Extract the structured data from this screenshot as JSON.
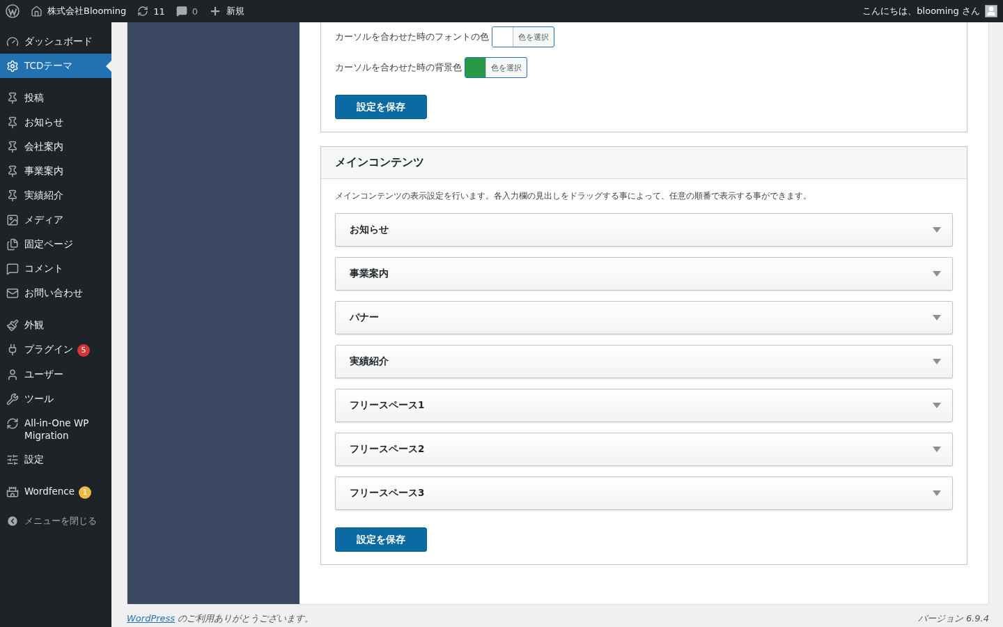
{
  "admin_bar": {
    "site_name": "株式会社Blooming",
    "updates": "11",
    "comments": "0",
    "new_label": "新規",
    "greeting": "こんにちは、blooming さん"
  },
  "sidebar": {
    "groups": [
      [
        {
          "label": "ダッシュボード",
          "selected": false
        },
        {
          "label": "TCDテーマ",
          "selected": true
        }
      ],
      [
        {
          "label": "投稿",
          "selected": false
        },
        {
          "label": "お知らせ",
          "selected": false
        },
        {
          "label": "会社案内",
          "selected": false
        },
        {
          "label": "事業案内",
          "selected": false
        },
        {
          "label": "実績紹介",
          "selected": false
        },
        {
          "label": "メディア",
          "selected": false
        },
        {
          "label": "固定ページ",
          "selected": false
        },
        {
          "label": "コメント",
          "selected": false
        },
        {
          "label": "お問い合わせ",
          "selected": false
        }
      ],
      [
        {
          "label": "外観",
          "selected": false
        },
        {
          "label": "プラグイン",
          "selected": false,
          "badge": {
            "text": "5",
            "color": "#d63638"
          }
        },
        {
          "label": "ユーザー",
          "selected": false
        },
        {
          "label": "ツール",
          "selected": false
        },
        {
          "label": "All-in-One WP Migration",
          "selected": false
        },
        {
          "label": "設定",
          "selected": false
        }
      ],
      [
        {
          "label": "Wordfence",
          "selected": false,
          "badge": {
            "text": "1",
            "color": "#f0b849"
          }
        }
      ]
    ],
    "collapse_label": "メニューを閉じる"
  },
  "color_rows": [
    {
      "label": "カーソルを合わせた時のフォントの色",
      "color": "#ffffff",
      "button": "色を選択"
    },
    {
      "label": "カーソルを合わせた時の背景色",
      "color": "#279a47",
      "button": "色を選択"
    }
  ],
  "save_button_top": "設定を保存",
  "main_section": {
    "title": "メインコンテンツ",
    "description": "メインコンテンツの表示設定を行います。各入力欄の見出しをドラッグする事によって、任意の順番で表示する事ができます。",
    "panels": [
      {
        "title": "お知らせ",
        "expanded": false
      },
      {
        "title": "事業案内",
        "expanded": false
      },
      {
        "title": "バナー",
        "expanded": false
      },
      {
        "title": "実績紹介",
        "expanded": false
      },
      {
        "title": "フリースペース1",
        "expanded": false
      },
      {
        "title": "フリースペース2",
        "expanded": false
      },
      {
        "title": "フリースペース3",
        "expanded": false
      }
    ],
    "save_button": "設定を保存"
  },
  "footer": {
    "link": "WordPress",
    "thanks": " のご利用ありがとうございます。",
    "version": "バージョン 6.9.4"
  }
}
